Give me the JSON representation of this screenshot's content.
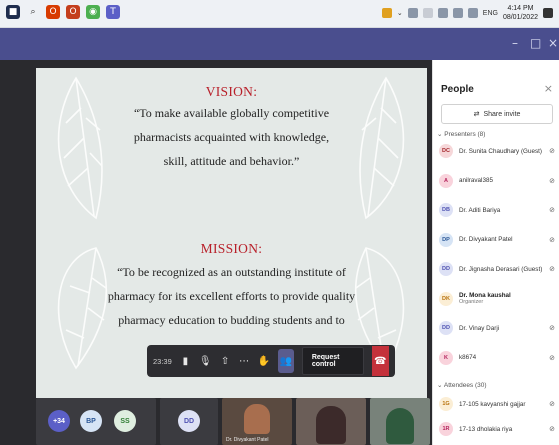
{
  "taskbar": {
    "tray_language": "ENG",
    "time": "4:14 PM",
    "date": "08/01/2022"
  },
  "window": {
    "minimize": "–",
    "maximize": "□",
    "close": "×"
  },
  "slide": {
    "vision_heading": "VISION:",
    "vision_line1": "“To make available globally competitive",
    "vision_line2": "pharmacists acquainted with knowledge,",
    "vision_line3": "skill, attitude and behavior.”",
    "mission_heading": "MISSION:",
    "mission_line1": "“To be recognized as an outstanding institute of",
    "mission_line2": "pharmacy for its excellent efforts to provide quality",
    "mission_line3": "pharmacy education to budding students and to"
  },
  "controls": {
    "timer": "23:39",
    "request_control": "Request control"
  },
  "strip": {
    "more_count": "+34",
    "tile1_initials": "BP",
    "tile2_initials": "SS",
    "tile3_initials": "DD",
    "tile4_name": "Dr. Divyakant Patel"
  },
  "people": {
    "title": "People",
    "share_invite": "Share invite",
    "presenters_label": "Presenters (8)",
    "attendees_label": "Attendees (30)",
    "presenters": [
      {
        "initials": "DC",
        "name": "Dr. Sunita Chaudhary (Guest)",
        "color": "#f6d7d9",
        "text": "#a4262c"
      },
      {
        "initials": "A",
        "name": "anilraval385",
        "color": "#f9d3dc",
        "text": "#b4235d"
      },
      {
        "initials": "DB",
        "name": "Dr. Aditi Bariya",
        "color": "#dde1f5",
        "text": "#4f52b2"
      },
      {
        "initials": "DP",
        "name": "Dr. Divyakant Patel",
        "color": "#d6e4f5",
        "text": "#2b5797"
      },
      {
        "initials": "DD",
        "name": "Dr. Jignasha Derasari (Guest)",
        "color": "#dde1f5",
        "text": "#4f52b2"
      },
      {
        "initials": "DK",
        "name": "Dr. Mona kaushal",
        "sub": "Organizer",
        "color": "#fbeed5",
        "text": "#b8720c"
      },
      {
        "initials": "DD",
        "name": "Dr. Vinay Darji",
        "color": "#dde1f5",
        "text": "#4f52b2"
      },
      {
        "initials": "K",
        "name": "k8674",
        "color": "#f9d3dc",
        "text": "#b4235d"
      }
    ],
    "attendees": [
      {
        "initials": "1G",
        "name": "17-105 kavyanshi gajjar",
        "color": "#fbeed5",
        "text": "#b8720c"
      },
      {
        "initials": "1R",
        "name": "17-13 dholakia riya",
        "color": "#f9d3dc",
        "text": "#b4235d"
      }
    ]
  }
}
